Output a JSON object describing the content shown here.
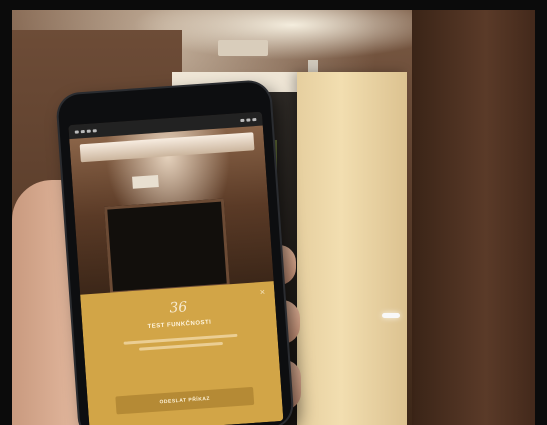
{
  "scene": {
    "description_colors": {
      "wall": "#5c3e2c",
      "door": "#f2deb0",
      "card": "#d2a547",
      "button": "#b58a35"
    }
  },
  "phone_app": {
    "card": {
      "logo": "36",
      "title": "TEST FUNKČNOSTI",
      "button_label": "ODESLAT PŘÍKAZ"
    }
  },
  "icons": [
    "close-icon"
  ]
}
